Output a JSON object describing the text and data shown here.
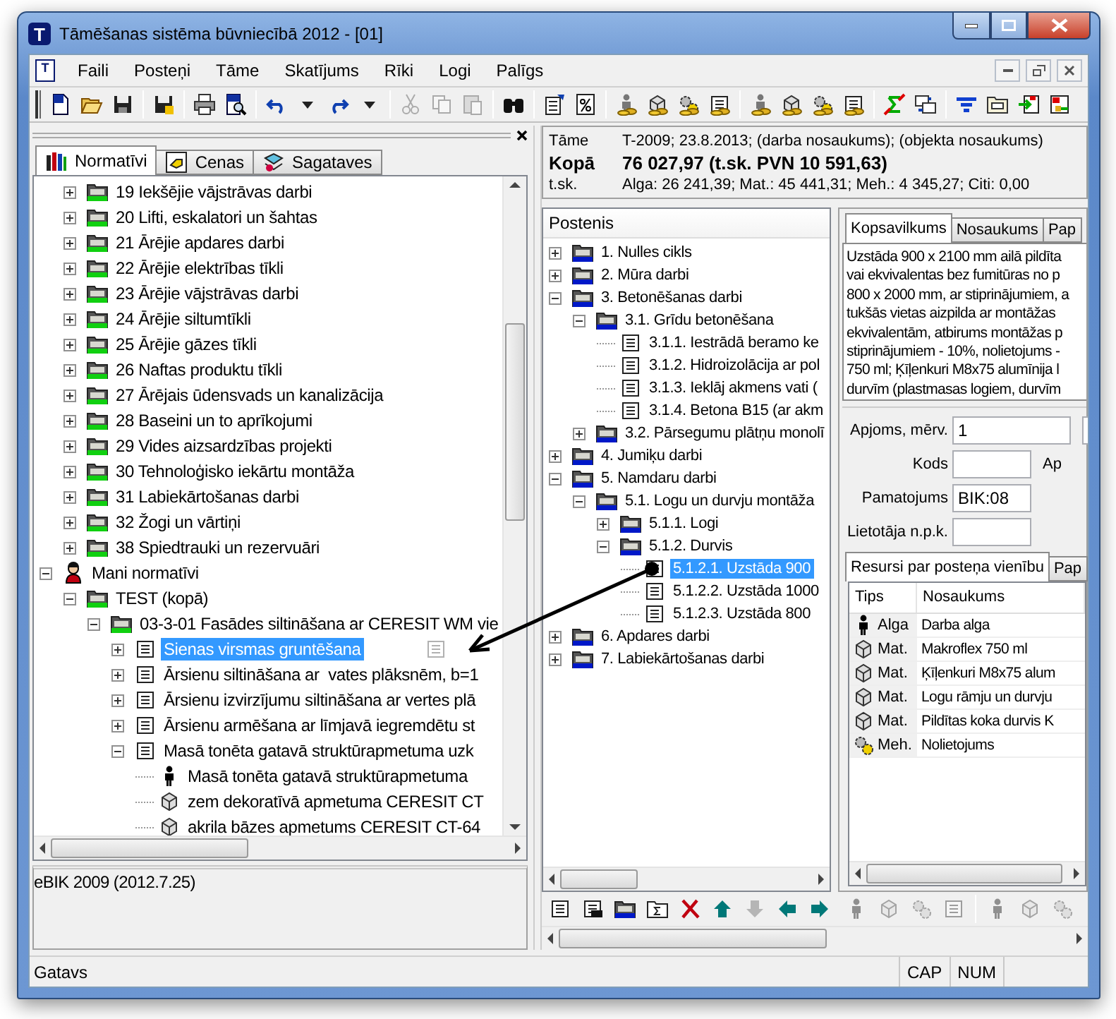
{
  "window": {
    "icon_letter": "T",
    "title": "Tāmēšanas sistēma būvniecībā 2012 - [01]"
  },
  "menu": {
    "icon_letter": "T",
    "items": [
      "Faili",
      "Posteņi",
      "Tāme",
      "Skatījums",
      "Rīki",
      "Logi",
      "Palīgs"
    ]
  },
  "toolbar": [
    {
      "kind": "new",
      "disabled": false
    },
    {
      "kind": "open",
      "disabled": false
    },
    {
      "kind": "save",
      "disabled": false
    },
    {
      "kind": "sep"
    },
    {
      "kind": "saveas",
      "disabled": false
    },
    {
      "kind": "sep"
    },
    {
      "kind": "print",
      "disabled": false
    },
    {
      "kind": "preview",
      "disabled": false
    },
    {
      "kind": "sep"
    },
    {
      "kind": "undo",
      "disabled": false
    },
    {
      "kind": "caret",
      "disabled": false
    },
    {
      "kind": "redo",
      "disabled": false
    },
    {
      "kind": "caret",
      "disabled": false
    },
    {
      "kind": "sep"
    },
    {
      "kind": "cut",
      "disabled": true
    },
    {
      "kind": "copy",
      "disabled": true
    },
    {
      "kind": "paste",
      "disabled": true
    },
    {
      "kind": "sep"
    },
    {
      "kind": "find",
      "disabled": false
    },
    {
      "kind": "sep"
    },
    {
      "kind": "editdoc",
      "disabled": false
    },
    {
      "kind": "percent",
      "disabled": false
    },
    {
      "kind": "sep"
    },
    {
      "kind": "workercoins",
      "disabled": false
    },
    {
      "kind": "cubecoins",
      "disabled": false
    },
    {
      "kind": "gearcoins",
      "disabled": false
    },
    {
      "kind": "doccoins",
      "disabled": false
    },
    {
      "kind": "sep"
    },
    {
      "kind": "workercoins",
      "disabled": false
    },
    {
      "kind": "cubecoins",
      "disabled": false
    },
    {
      "kind": "gearcoins",
      "disabled": false
    },
    {
      "kind": "doccoins",
      "disabled": false
    },
    {
      "kind": "sep"
    },
    {
      "kind": "sigma",
      "disabled": false
    },
    {
      "kind": "swap",
      "disabled": false
    },
    {
      "kind": "sep"
    },
    {
      "kind": "filter",
      "disabled": false
    },
    {
      "kind": "counter",
      "disabled": false
    },
    {
      "kind": "import",
      "disabled": false
    },
    {
      "kind": "export",
      "disabled": false
    }
  ],
  "left_panel": {
    "tabs": [
      {
        "label": "Normatīvi",
        "selected": true
      },
      {
        "label": "Cenas",
        "selected": false
      },
      {
        "label": "Sagataves",
        "selected": false
      }
    ],
    "tree": {
      "scrolled_items": [
        {
          "label": "19 Iekšējie vājstrāvas darbi",
          "kind": "folder-green",
          "expanded": false,
          "selected": false
        },
        {
          "label": "20 Lifti, eskalatori un šahtas",
          "kind": "folder-green",
          "expanded": false,
          "selected": false
        },
        {
          "label": "21 Ārējie apdares darbi",
          "kind": "folder-green",
          "expanded": false,
          "selected": false
        },
        {
          "label": "22 Ārējie elektrības tīkli",
          "kind": "folder-green",
          "expanded": false,
          "selected": false
        },
        {
          "label": "23 Ārējie vājstrāvas darbi",
          "kind": "folder-green",
          "expanded": false,
          "selected": false
        },
        {
          "label": "24 Ārējie siltumtīkli",
          "kind": "folder-green",
          "expanded": false,
          "selected": false
        },
        {
          "label": "25 Ārējie gāzes tīkli",
          "kind": "folder-green",
          "expanded": false,
          "selected": false
        },
        {
          "label": "26 Naftas produktu tīkli",
          "kind": "folder-green",
          "expanded": false,
          "selected": false
        },
        {
          "label": "27 Ārējais ūdensvads un kanalizācija",
          "kind": "folder-green",
          "expanded": false,
          "selected": false
        },
        {
          "label": "28 Baseini un to aprīkojumi",
          "kind": "folder-green",
          "expanded": false,
          "selected": false
        },
        {
          "label": "29 Vides aizsardzības projekti",
          "kind": "folder-green",
          "expanded": false,
          "selected": false
        },
        {
          "label": "30 Tehnoloģisko iekārtu montāža",
          "kind": "folder-green",
          "expanded": false,
          "selected": false
        },
        {
          "label": "31 Labiekārtošanas darbi",
          "kind": "folder-green",
          "expanded": false,
          "selected": false
        },
        {
          "label": "32 Žogi un vārtiņi",
          "kind": "folder-green",
          "expanded": false,
          "selected": false
        },
        {
          "label": "38 Spiedtrauki un rezervuāri",
          "kind": "folder-green",
          "expanded": false,
          "selected": false
        }
      ],
      "nodes": [
        {
          "label": "Mani normatīvi",
          "kind": "user",
          "expanded": true,
          "selected": false,
          "children": [
            {
              "label": "TEST (kopā)",
              "kind": "folder-green",
              "expanded": true,
              "selected": false,
              "children": [
                {
                  "label": "03-3-01 Fasādes siltināšana ar CERESIT WM vie",
                  "kind": "folder-green",
                  "expanded": true,
                  "selected": false,
                  "children": [
                    {
                      "label": "Sienas virsmas gruntēšana",
                      "kind": "doc",
                      "expanded": false,
                      "selected": true
                    },
                    {
                      "label": "Ārsienu siltināšana ar  vates plāksnēm, b=1",
                      "kind": "doc",
                      "expanded": false,
                      "selected": false
                    },
                    {
                      "label": "Ārsienu izvirzījumu siltināšana ar vertes plā",
                      "kind": "doc",
                      "expanded": false,
                      "selected": false
                    },
                    {
                      "label": "Ārsienu armēšana ar līmjavā iegremdētu st",
                      "kind": "doc",
                      "expanded": false,
                      "selected": false
                    },
                    {
                      "label": "Masā tonēta gatavā struktūrapmetuma uzk",
                      "kind": "doc",
                      "expanded": true,
                      "selected": false,
                      "children": [
                        {
                          "label": "Masā tonēta gatavā struktūrapmetuma",
                          "kind": "person",
                          "selected": false
                        },
                        {
                          "label": "zem dekoratīvā apmetuma CERESIT CT",
                          "kind": "cube",
                          "selected": false
                        },
                        {
                          "label": "akrila bāzes apmetums CERESIT CT-64",
                          "kind": "cube",
                          "selected": false
                        }
                      ]
                    }
                  ]
                }
              ]
            }
          ]
        }
      ]
    },
    "info": "eBIK 2009 (2012.7.25)"
  },
  "estimate": [
    {
      "label": "Tāme",
      "value": "T-2009; 23.8.2013; (darba nosaukums); (objekta nosaukums)",
      "kind": "plain"
    },
    {
      "label": "Kopā",
      "value": "76 027,97 (t.sk. PVN 10 591,63)",
      "kind": "total"
    },
    {
      "label": "t.sk.",
      "value": "Alga: 26 241,39; Mat.: 45 441,31; Meh.: 4 345,27; Citi: 0,00",
      "kind": "plain"
    }
  ],
  "positions": {
    "header": "Postenis",
    "tree": [
      {
        "label": "1. Nulles cikls",
        "kind": "folder-blue",
        "expanded": false,
        "selected": false
      },
      {
        "label": "2. Mūra darbi",
        "kind": "folder-blue",
        "expanded": false,
        "selected": false
      },
      {
        "label": "3. Betonēšanas darbi",
        "kind": "folder-blue",
        "expanded": true,
        "selected": false,
        "children": [
          {
            "label": "3.1. Grīdu betonēšana",
            "kind": "folder-blue",
            "expanded": true,
            "selected": false,
            "children": [
              {
                "label": "3.1.1. Iestrādā beramo ke",
                "kind": "doc",
                "selected": false
              },
              {
                "label": "3.1.2. Hidroizolācija ar pol",
                "kind": "doc",
                "selected": false
              },
              {
                "label": "3.1.3. Ieklāj akmens vati (",
                "kind": "doc",
                "selected": false
              },
              {
                "label": "3.1.4. Betona B15 (ar akm",
                "kind": "doc",
                "selected": false
              }
            ]
          },
          {
            "label": "3.2. Pārsegumu plātņu monolī",
            "kind": "folder-blue",
            "expanded": false,
            "selected": false
          }
        ]
      },
      {
        "label": "4. Jumiķu darbi",
        "kind": "folder-blue",
        "expanded": false,
        "selected": false
      },
      {
        "label": "5. Namdaru darbi",
        "kind": "folder-blue",
        "expanded": true,
        "selected": false,
        "children": [
          {
            "label": "5.1. Logu un durvju montāža",
            "kind": "folder-blue",
            "expanded": true,
            "selected": false,
            "children": [
              {
                "label": "5.1.1. Logi",
                "kind": "folder-blue",
                "expanded": false,
                "selected": false
              },
              {
                "label": "5.1.2. Durvis",
                "kind": "folder-blue",
                "expanded": true,
                "selected": false,
                "children": [
                  {
                    "label": "5.1.2.1. Uzstāda 900",
                    "kind": "doc",
                    "selected": true
                  },
                  {
                    "label": "5.1.2.2. Uzstāda 1000",
                    "kind": "doc",
                    "selected": false
                  },
                  {
                    "label": "5.1.2.3. Uzstāda 800",
                    "kind": "doc",
                    "selected": false
                  }
                ]
              }
            ]
          }
        ]
      },
      {
        "label": "6. Apdares darbi",
        "kind": "folder-blue",
        "expanded": false,
        "selected": false
      },
      {
        "label": "7. Labiekārtošanas darbi",
        "kind": "folder-blue",
        "expanded": false,
        "selected": false
      }
    ],
    "toolbar": [
      {
        "kind": "doc",
        "disabled": false
      },
      {
        "kind": "docmachine",
        "disabled": false
      },
      {
        "kind": "folderblue",
        "disabled": false
      },
      {
        "kind": "sigmadoc",
        "disabled": false
      },
      {
        "kind": "delete",
        "disabled": false
      },
      {
        "kind": "up",
        "disabled": false
      },
      {
        "kind": "down",
        "disabled": true
      },
      {
        "kind": "left",
        "disabled": false
      },
      {
        "kind": "right",
        "disabled": false
      }
    ]
  },
  "details": {
    "tabs": [
      {
        "label": "Kopsavilkums",
        "selected": true
      },
      {
        "label": "Nosaukums",
        "selected": false
      },
      {
        "label": "Pap",
        "selected": false
      }
    ],
    "description_lines": [
      "Uzstāda 900 x 2100 mm ailā pildīta",
      "vai ekvivalentas bez fumitūras no p",
      "800 x 2000 mm, ar stiprinājumiem, a",
      "tukšās vietas aizpilda ar montāžas",
      "ekvivalentām, atbirums montāžas p",
      "stiprinājumiem - 10%, nolietojums -",
      "750 ml; Ķīļenkuri M8x75 alumīnija l",
      "durvīm (plastmasas logiem, durvīm"
    ],
    "fields": [
      {
        "label": "Apjoms, mērv.",
        "value": "1",
        "kind": "quantity"
      },
      {
        "label": "Kods",
        "kind": "text",
        "side_label": "Ap"
      },
      {
        "label": "Pamatojums",
        "value": "BIK:08",
        "kind": "text"
      },
      {
        "label": "Lietotāja n.p.k.",
        "kind": "text"
      }
    ],
    "resource_tabs": [
      {
        "label": "Resursi par posteņa vienību",
        "selected": true
      },
      {
        "label": "Pap",
        "selected": false
      }
    ],
    "resources": {
      "columns": [
        "Tips",
        "Nosaukums"
      ],
      "rows": [
        {
          "kind": "person",
          "type": "Alga",
          "name": "Darba alga"
        },
        {
          "kind": "cube",
          "type": "Mat.",
          "name": "Makroflex 750 ml"
        },
        {
          "kind": "cube",
          "type": "Mat.",
          "name": "Ķīļenkuri M8x75 alum"
        },
        {
          "kind": "cube",
          "type": "Mat.",
          "name": "Logu rāmju un durvju"
        },
        {
          "kind": "cube",
          "type": "Mat.",
          "name": "Pildītas koka durvis K"
        },
        {
          "kind": "gear",
          "type": "Meh.",
          "name": "Nolietojums"
        }
      ]
    },
    "toolbar": [
      {
        "kind": "person",
        "disabled": true
      },
      {
        "kind": "cube",
        "disabled": true
      },
      {
        "kind": "gear",
        "disabled": true
      },
      {
        "kind": "doc",
        "disabled": true
      },
      {
        "kind": "sep"
      },
      {
        "kind": "person",
        "disabled": true
      },
      {
        "kind": "cube",
        "disabled": true
      },
      {
        "kind": "gear",
        "disabled": true
      }
    ]
  },
  "status_bar": {
    "text": "Gatavs",
    "indicators": [
      "CAP",
      "NUM"
    ]
  }
}
